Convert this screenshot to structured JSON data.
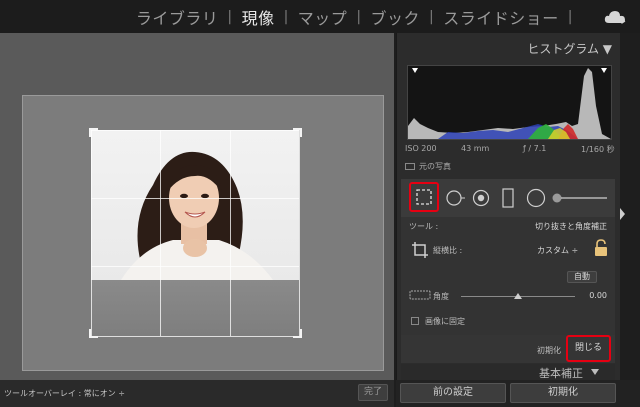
{
  "modules": [
    "ライブラリ",
    "現像",
    "マップ",
    "ブック",
    "スライドショー"
  ],
  "active_module": "現像",
  "icons": {
    "cloud": "cloud-icon",
    "crop": "crop-overlay-icon",
    "spot": "spot-removal-icon",
    "redeye": "red-eye-icon",
    "gradient": "graduated-filter-icon",
    "radial": "radial-filter-icon",
    "brush": "adjustment-brush-icon",
    "lock": "lock-icon",
    "angle": "straighten-icon"
  },
  "panel": {
    "histogram_title": "ヒストグラム ▼",
    "iso": "ISO 200",
    "focal": "43 mm",
    "aperture": "ƒ / 7.1",
    "shutter": "1/160 秒",
    "original_photo": "元の写真",
    "tool_label": "ツール :",
    "tool_value": "切り抜きと角度補正",
    "aspect_label": "縦横比 :",
    "aspect_value": "カスタム ÷",
    "auto_button": "自動",
    "angle_label": "角度",
    "angle_value": "0.00",
    "constrain_label": "画像に固定",
    "reset_label": "初期化",
    "close_label": "閉じる",
    "basic_label": "基本補正"
  },
  "toolbar": {
    "overlay_label": "ツールオーバーレイ : 常にオン ÷",
    "done_label": "完了"
  },
  "bottom": {
    "previous_label": "前の設定",
    "reset_label": "初期化"
  },
  "colors": {
    "highlight": "#e60012"
  }
}
